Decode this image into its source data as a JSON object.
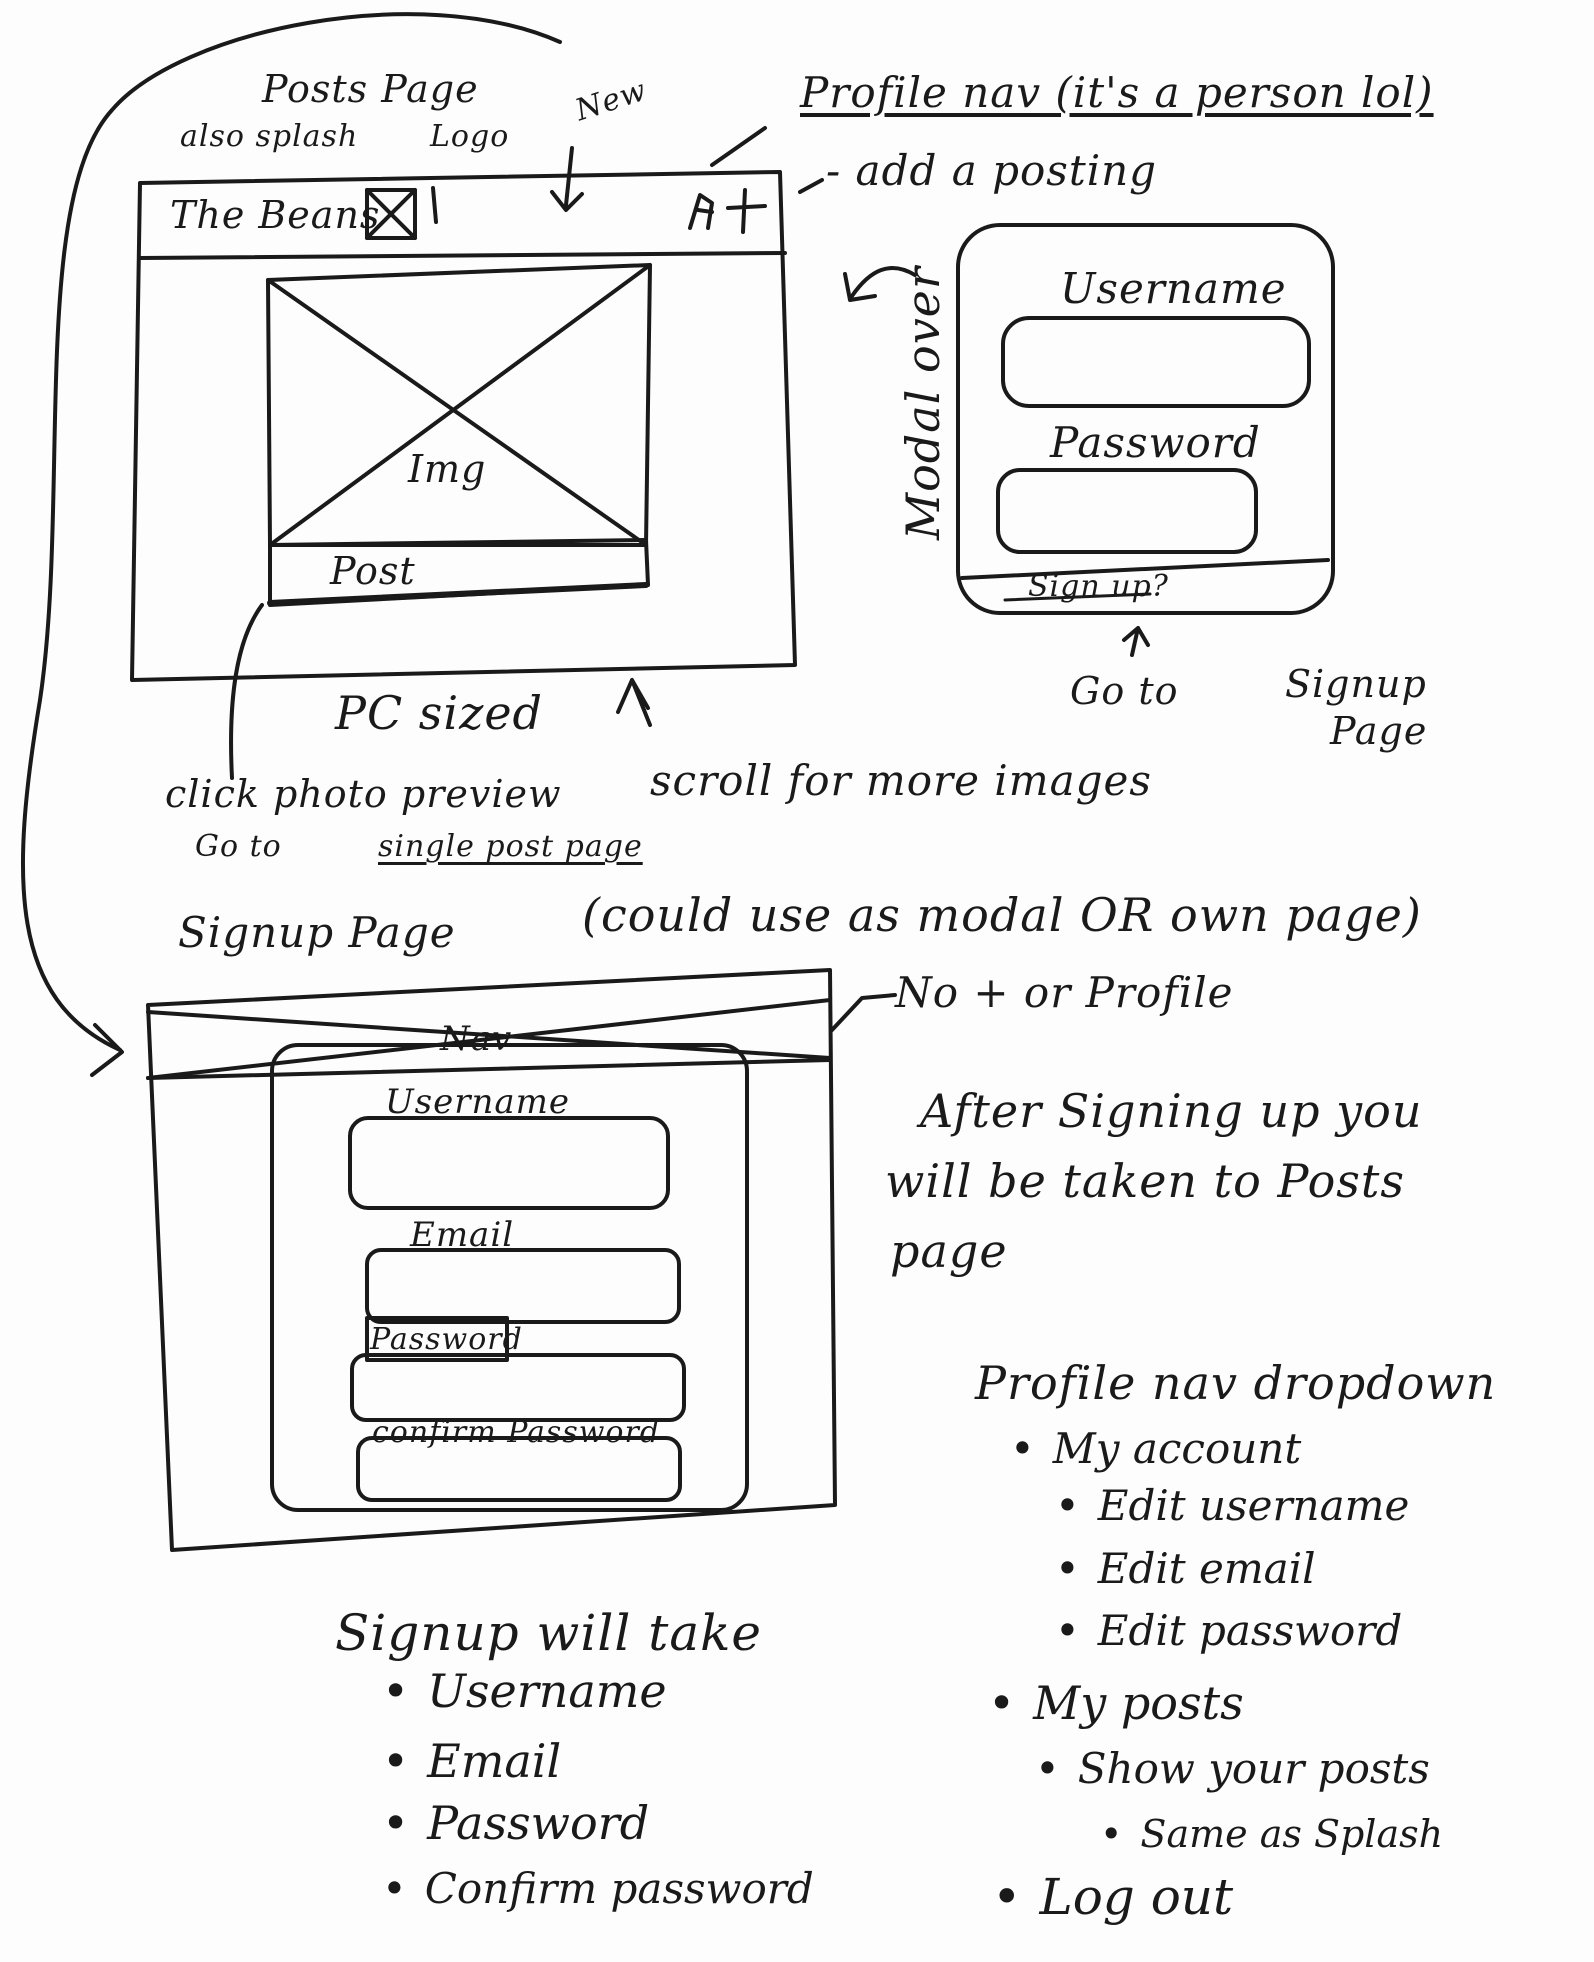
{
  "posts_sketch": {
    "title": "Posts Page",
    "subtitle": "also splash",
    "logo_note": "Logo",
    "new_note": "New",
    "profile_note": "Profile nav (it's a person lol)",
    "add_note": "- add a posting",
    "brand": "The Beans",
    "img_label": "Img",
    "post_label": "Post",
    "pc_sized": "PC sized",
    "scroll_note": "scroll for more images",
    "click_note": "click photo preview",
    "click_note_2": "Go to",
    "single_post_link": "single post page"
  },
  "modal_sketch": {
    "side_label": "Modal over",
    "username_label": "Username",
    "password_label": "Password",
    "signup_link": "Sign up?",
    "goto_note": "Go to",
    "goto_target_1": "Signup",
    "goto_target_2": "Page"
  },
  "signup_sketch": {
    "title": "Signup Page",
    "modal_note": "(could use as modal OR own page)",
    "no_plus_note": "No + or Profile",
    "nav_label": "Nav",
    "username_label": "Username",
    "email_label": "Email",
    "password_label": "Password",
    "confirm_label": "confirm Password",
    "after_line_1": "After Signing up you",
    "after_line_2": "will be taken to Posts",
    "after_line_3": "page"
  },
  "signup_takes": {
    "heading": "Signup will take",
    "items": [
      "Username",
      "Email",
      "Password",
      "Confirm password"
    ]
  },
  "profile_dropdown": {
    "heading": "Profile nav dropdown",
    "my_account": "My account",
    "edit_username": "Edit username",
    "edit_email": "Edit email",
    "edit_password": "Edit password",
    "my_posts": "My posts",
    "show_posts": "Show your posts",
    "same_as_splash": "Same as Splash",
    "log_out": "Log out"
  },
  "colors": {
    "ink": "#1a1a1a",
    "paper": "#fdfdfd"
  }
}
